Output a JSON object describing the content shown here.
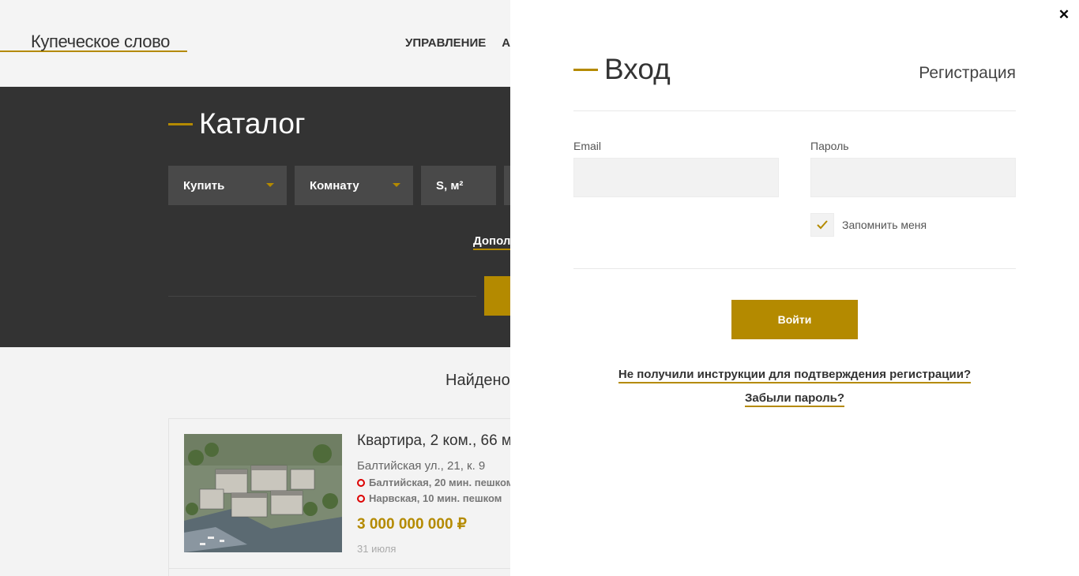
{
  "header": {
    "logo": "Купеческое слово",
    "nav": [
      "УПРАВЛЕНИЕ",
      "АР"
    ]
  },
  "catalog": {
    "title": "Каталог",
    "filters": [
      {
        "label": "Купить",
        "has_caret": true
      },
      {
        "label": "Комнату",
        "has_caret": true
      },
      {
        "label": "S, м²",
        "has_caret": false
      }
    ],
    "advanced_link": "Дополн"
  },
  "results": {
    "found_label": "Найдено",
    "card": {
      "title": "Квартира, 2 ком., 66 м",
      "address": "Балтийская ул., 21, к. 9",
      "metro": [
        "Балтийская, 20 мин. пешком",
        "Нарвская, 10 мин. пешком"
      ],
      "price": "3 000 000 000 ₽",
      "date": "31 июля"
    }
  },
  "login": {
    "title": "Вход",
    "register_link": "Регистрация",
    "email_label": "Email",
    "password_label": "Пароль",
    "remember_label": "Запомнить меня",
    "remember_checked": true,
    "submit_label": "Войти",
    "resend_link": "Не получили инструкции для подтверждения регистрации?",
    "forgot_link": "Забыли  пароль?",
    "close_icon": "close-icon"
  },
  "colors": {
    "accent": "#b48a00",
    "dark_bg": "#333333",
    "metro_red": "#dd0000"
  }
}
